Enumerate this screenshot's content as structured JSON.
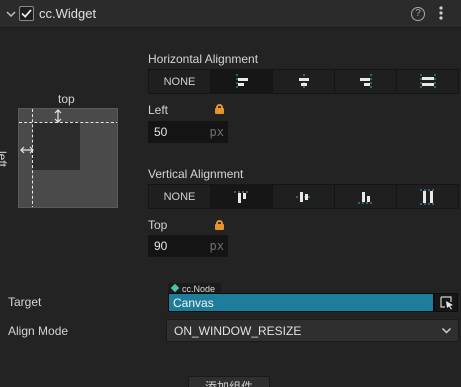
{
  "component": {
    "title": "cc.Widget",
    "enabled": true,
    "help_glyph": "?"
  },
  "diagram": {
    "top_label": "top",
    "left_label": "left"
  },
  "horizontal": {
    "title": "Horizontal Alignment",
    "buttons": [
      {
        "label": "NONE"
      },
      {
        "icon": "align-left-icon"
      },
      {
        "icon": "align-h-center-icon"
      },
      {
        "icon": "align-right-icon"
      },
      {
        "icon": "stretch-horizontal-icon"
      }
    ],
    "field_label": "Left",
    "value": "50",
    "unit": "px"
  },
  "vertical": {
    "title": "Vertical Alignment",
    "buttons": [
      {
        "label": "NONE"
      },
      {
        "icon": "align-top-icon"
      },
      {
        "icon": "align-v-center-icon"
      },
      {
        "icon": "align-bottom-icon"
      },
      {
        "icon": "stretch-vertical-icon"
      }
    ],
    "field_label": "Top",
    "value": "90",
    "unit": "px"
  },
  "target": {
    "label": "Target",
    "type_tag": "cc.Node",
    "value": "Canvas"
  },
  "align_mode": {
    "label": "Align Mode",
    "value": "ON_WINDOW_RESIZE"
  },
  "add_component": {
    "label": "添加组件"
  },
  "colors": {
    "accent_blue": "#1e7d9b",
    "lock_orange": "#e8942c",
    "node_green": "#4cc3a0",
    "guide_cyan": "#3fa7c9"
  }
}
